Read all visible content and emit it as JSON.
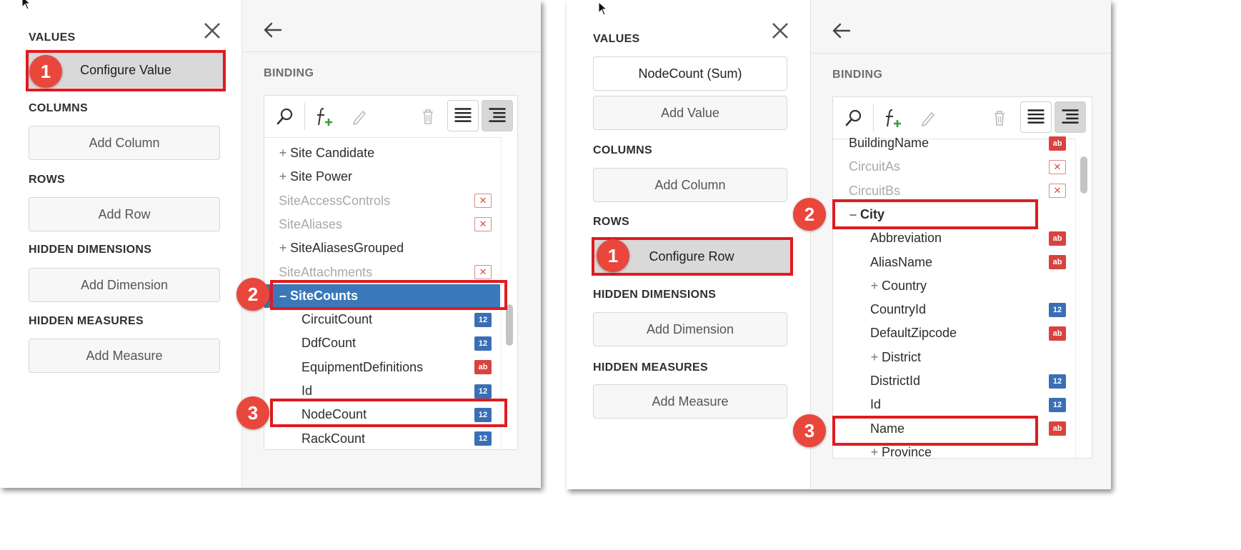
{
  "left_shot": {
    "values_label": "VALUES",
    "configure_label": "Configure Value",
    "columns_label": "COLUMNS",
    "add_column": "Add Column",
    "rows_label": "ROWS",
    "add_row": "Add Row",
    "hidden_dimensions_label": "HIDDEN DIMENSIONS",
    "add_dimension": "Add Dimension",
    "hidden_measures_label": "HIDDEN MEASURES",
    "add_measure": "Add Measure",
    "binding_label": "BINDING",
    "badges": [
      "1",
      "2",
      "3"
    ],
    "tree_items": [
      {
        "label": "Site Candidate",
        "expander": "+",
        "type": ""
      },
      {
        "label": "Site Power",
        "expander": "+",
        "type": ""
      },
      {
        "label": "SiteAccessControls",
        "expander": "",
        "type": "none"
      },
      {
        "label": "SiteAliases",
        "expander": "",
        "type": "none"
      },
      {
        "label": "SiteAliasesGrouped",
        "expander": "+",
        "type": ""
      },
      {
        "label": "SiteAttachments",
        "expander": "",
        "type": "none"
      },
      {
        "label": "SiteCounts",
        "expander": "–",
        "type": ""
      },
      {
        "label": "CircuitCount",
        "expander": "",
        "type": "num"
      },
      {
        "label": "DdfCount",
        "expander": "",
        "type": "num"
      },
      {
        "label": "EquipmentDefinitions",
        "expander": "",
        "type": "str"
      },
      {
        "label": "Id",
        "expander": "",
        "type": "num"
      },
      {
        "label": "NodeCount",
        "expander": "",
        "type": "num"
      },
      {
        "label": "RackCount",
        "expander": "",
        "type": "num"
      }
    ],
    "scroll_position": 0.62
  },
  "right_shot": {
    "values_label": "VALUES",
    "value_item": "NodeCount (Sum)",
    "add_value": "Add Value",
    "columns_label": "COLUMNS",
    "add_column": "Add Column",
    "rows_label": "ROWS",
    "configure_label": "Configure Row",
    "hidden_dimensions_label": "HIDDEN DIMENSIONS",
    "add_dimension": "Add Dimension",
    "hidden_measures_label": "HIDDEN MEASURES",
    "add_measure": "Add Measure",
    "binding_label": "BINDING",
    "badges": [
      "1",
      "2",
      "3"
    ],
    "tree_items": [
      {
        "label": "BuildingName",
        "expander": "",
        "type": "str"
      },
      {
        "label": "CircuitAs",
        "expander": "",
        "type": "none"
      },
      {
        "label": "CircuitBs",
        "expander": "",
        "type": "none"
      },
      {
        "label": "City",
        "expander": "–",
        "type": ""
      },
      {
        "label": "Abbreviation",
        "expander": "",
        "type": "str"
      },
      {
        "label": "AliasName",
        "expander": "",
        "type": "str"
      },
      {
        "label": "Country",
        "expander": "+",
        "type": ""
      },
      {
        "label": "CountryId",
        "expander": "",
        "type": "num"
      },
      {
        "label": "DefaultZipcode",
        "expander": "",
        "type": "str"
      },
      {
        "label": "District",
        "expander": "+",
        "type": ""
      },
      {
        "label": "DistrictId",
        "expander": "",
        "type": "num"
      },
      {
        "label": "Id",
        "expander": "",
        "type": "num"
      },
      {
        "label": "Name",
        "expander": "",
        "type": "str"
      },
      {
        "label": "Province",
        "expander": "+",
        "type": ""
      }
    ],
    "scroll_position": 0.05
  },
  "type_glyphs": {
    "num": "12",
    "str": "ab",
    "none": "✕"
  },
  "colors": {
    "highlight": "#e01b1f",
    "badge": "#e9473c",
    "selected_row": "#3a78b9",
    "num_type": "#3a6fb6",
    "str_type": "#d9433d"
  }
}
